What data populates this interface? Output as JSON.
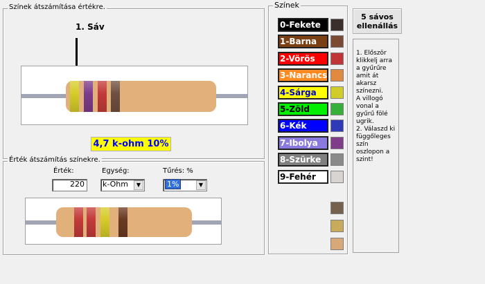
{
  "decode_group": {
    "title": "Színek átszámítása értékre.",
    "band_marker": "1. Sáv",
    "result": "4,7 k-ohm 10%"
  },
  "encode_group": {
    "title": "Érték átszámítás színekre.",
    "value_label": "Érték:",
    "value": "220",
    "unit_label": "Egység:",
    "unit_selected": "k-Ohm",
    "tolerance_label": "Tűrés: %",
    "tolerance_selected": "1%"
  },
  "colors_group": {
    "title": "Színek",
    "items": [
      {
        "label": "0-Fekete",
        "bg": "#000000",
        "fg": "#ffffff",
        "swatch": "#3a2f2a"
      },
      {
        "label": "1-Barna",
        "bg": "#7a3f12",
        "fg": "#ffffff",
        "swatch": "#7a4a32"
      },
      {
        "label": "2-Vörös",
        "bg": "#ff0000",
        "fg": "#ffffff",
        "swatch": "#c03636"
      },
      {
        "label": "3-Narancs",
        "bg": "#ff8a1f",
        "fg": "#ffffff",
        "swatch": "#e08a40"
      },
      {
        "label": "4-Sárga",
        "bg": "#ffff00",
        "fg": "#0000cc",
        "swatch": "#d2cc2a"
      },
      {
        "label": "5-Zöld",
        "bg": "#00ee00",
        "fg": "#000000",
        "swatch": "#36b036"
      },
      {
        "label": "6-Kék",
        "bg": "#0000ff",
        "fg": "#ffffff",
        "swatch": "#2e3ab8"
      },
      {
        "label": "7-Ibolya",
        "bg": "#8a7ae0",
        "fg": "#ffffff",
        "swatch": "#7e3c8a"
      },
      {
        "label": "8-Szürke",
        "bg": "#808080",
        "fg": "#ffffff",
        "swatch": "#8a8a8a"
      },
      {
        "label": "9-Fehér",
        "bg": "#ffffff",
        "fg": "#000000",
        "swatch": "#d8d4d0"
      }
    ],
    "extra_swatches": [
      "#76604e",
      "#c8aa5a",
      "#d8a878"
    ]
  },
  "five_band_button": "5 sávos ellenállás",
  "help_text": " 1. Először klikkelj arra a gyűrűre amit át akarsz színezni.\nA villogó vonal a gyűrű fölé ugrik.\n2. Válaszd ki függőleges szín oszlopon a szint!",
  "top_resistor_bands": [
    "#d6cc2a",
    "#7e3c8a",
    "#c43a3a",
    "#705040"
  ],
  "bottom_resistor_bands": [
    "#c43a3a",
    "#c43a3a",
    "#d6cc2a",
    "#6a3a22"
  ]
}
